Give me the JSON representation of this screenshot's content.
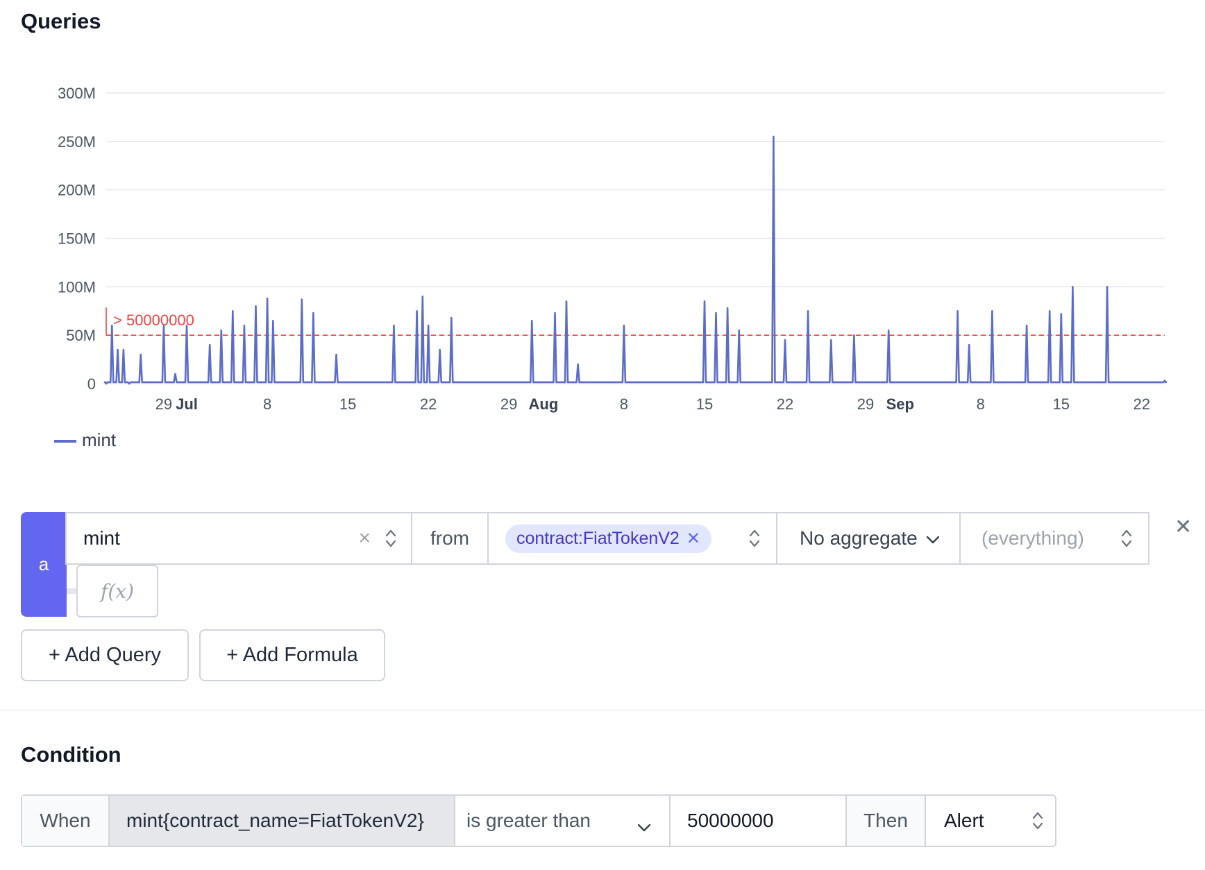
{
  "queries_title": "Queries",
  "condition_title": "Condition",
  "chart_data": {
    "type": "line",
    "title": "",
    "ylim": [
      0,
      300000000
    ],
    "y_ticks": [
      "300M",
      "250M",
      "200M",
      "150M",
      "100M",
      "50M",
      "0"
    ],
    "x_ticks": [
      {
        "label": "29",
        "bold": false
      },
      {
        "label": "Jul",
        "bold": true
      },
      {
        "label": "8",
        "bold": false
      },
      {
        "label": "15",
        "bold": false
      },
      {
        "label": "22",
        "bold": false
      },
      {
        "label": "29",
        "bold": false
      },
      {
        "label": "Aug",
        "bold": true
      },
      {
        "label": "8",
        "bold": false
      },
      {
        "label": "15",
        "bold": false
      },
      {
        "label": "22",
        "bold": false
      },
      {
        "label": "29",
        "bold": false
      },
      {
        "label": "Sep",
        "bold": true
      },
      {
        "label": "8",
        "bold": false
      },
      {
        "label": "15",
        "bold": false
      },
      {
        "label": "22",
        "bold": false
      }
    ],
    "x_range": [
      "2024-06-24",
      "2024-09-24"
    ],
    "threshold": {
      "value": 50000000,
      "label": "> 50000000",
      "color": "#ef4444"
    },
    "line_color": "#5b6dc8",
    "grid": true,
    "legend_position": "bottom-left",
    "series": [
      {
        "name": "mint",
        "x": [
          "2024-06-24",
          "2024-06-24T12",
          "2024-06-25",
          "2024-06-25T12",
          "2024-06-26",
          "2024-06-27",
          "2024-06-29",
          "2024-06-30",
          "2024-07-01",
          "2024-07-03",
          "2024-07-04",
          "2024-07-05",
          "2024-07-06",
          "2024-07-07",
          "2024-07-08",
          "2024-07-08T12",
          "2024-07-11",
          "2024-07-12",
          "2024-07-14",
          "2024-07-19",
          "2024-07-21",
          "2024-07-21T12",
          "2024-07-22",
          "2024-07-23",
          "2024-07-24",
          "2024-07-31",
          "2024-08-02",
          "2024-08-03",
          "2024-08-04",
          "2024-08-08",
          "2024-08-15",
          "2024-08-16",
          "2024-08-17",
          "2024-08-18",
          "2024-08-21",
          "2024-08-22",
          "2024-08-24",
          "2024-08-26",
          "2024-08-28",
          "2024-08-31",
          "2024-09-06",
          "2024-09-07",
          "2024-09-09",
          "2024-09-12",
          "2024-09-14",
          "2024-09-15",
          "2024-09-16",
          "2024-09-19",
          "2024-09-24"
        ],
        "values": [
          0,
          60000000,
          35000000,
          35000000,
          0,
          30000000,
          60000000,
          10000000,
          60000000,
          40000000,
          55000000,
          75000000,
          60000000,
          80000000,
          88000000,
          65000000,
          87000000,
          73000000,
          30000000,
          60000000,
          75000000,
          90000000,
          60000000,
          35000000,
          68000000,
          65000000,
          73000000,
          85000000,
          20000000,
          60000000,
          85000000,
          73000000,
          78000000,
          55000000,
          255000000,
          45000000,
          75000000,
          45000000,
          50000000,
          55000000,
          75000000,
          40000000,
          75000000,
          60000000,
          75000000,
          72000000,
          100000000,
          100000000,
          3000000
        ]
      }
    ]
  },
  "query": {
    "letter": "a",
    "metric": "mint",
    "from_label": "from",
    "filter_tag": "contract:FiatTokenV2",
    "aggregate": "No aggregate",
    "group_by_placeholder": "(everything)",
    "formula_label": "f(x)"
  },
  "buttons": {
    "add_query": "+ Add Query",
    "add_formula": "+ Add Formula"
  },
  "condition": {
    "when_label": "When",
    "expression": "mint{contract_name=FiatTokenV2}",
    "operator": "is greater than",
    "value": "50000000",
    "then_label": "Then",
    "action": "Alert"
  },
  "icons": {
    "clear": "close-icon",
    "stepper": "up-down-icon",
    "dropdown": "chevron-down-icon",
    "remove_row": "close-icon"
  }
}
